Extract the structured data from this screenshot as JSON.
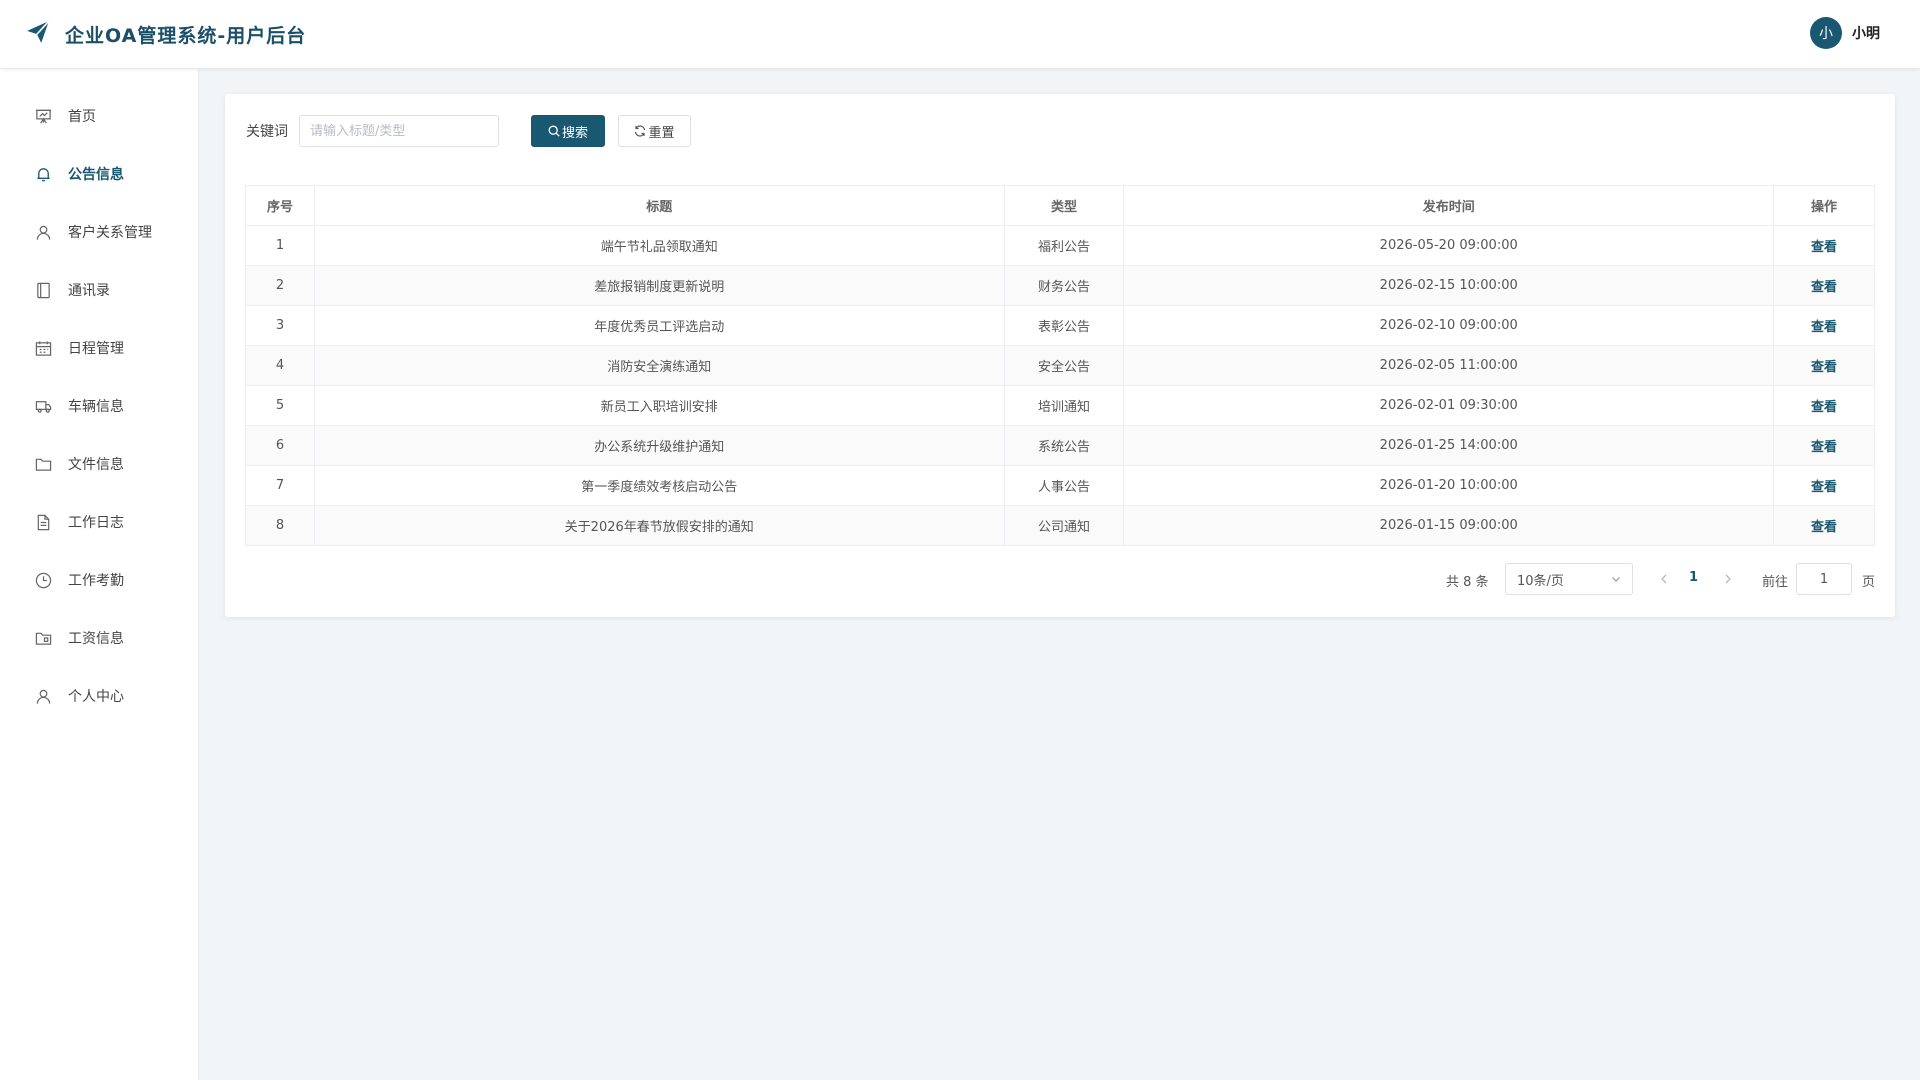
{
  "header": {
    "title": "企业OA管理系统-用户后台",
    "brand_color": "#1a5872",
    "user": {
      "avatar_text": "小",
      "name": "小明"
    }
  },
  "sidebar": {
    "items": [
      {
        "label": "首页",
        "icon": "presentation-icon",
        "active": false
      },
      {
        "label": "公告信息",
        "icon": "bell-icon",
        "active": true
      },
      {
        "label": "客户关系管理",
        "icon": "user-icon",
        "active": false
      },
      {
        "label": "通讯录",
        "icon": "notebook-icon",
        "active": false
      },
      {
        "label": "日程管理",
        "icon": "calendar-icon",
        "active": false
      },
      {
        "label": "车辆信息",
        "icon": "truck-icon",
        "active": false
      },
      {
        "label": "文件信息",
        "icon": "folder-icon",
        "active": false
      },
      {
        "label": "工作日志",
        "icon": "document-icon",
        "active": false
      },
      {
        "label": "工作考勤",
        "icon": "clock-icon",
        "active": false
      },
      {
        "label": "工资信息",
        "icon": "folder-money-icon",
        "active": false
      },
      {
        "label": "个人中心",
        "icon": "user-icon",
        "active": false
      }
    ]
  },
  "search": {
    "label": "关键词",
    "value": "",
    "placeholder": "请输入标题/类型",
    "search_button": "搜索",
    "reset_button": "重置"
  },
  "table": {
    "columns": [
      "序号",
      "标题",
      "类型",
      "发布时间",
      "操作"
    ],
    "rows": [
      {
        "index": "1",
        "title": "端午节礼品领取通知",
        "type": "福利公告",
        "time": "2026-05-20 09:00:00",
        "action": "查看"
      },
      {
        "index": "2",
        "title": "差旅报销制度更新说明",
        "type": "财务公告",
        "time": "2026-02-15 10:00:00",
        "action": "查看"
      },
      {
        "index": "3",
        "title": "年度优秀员工评选启动",
        "type": "表彰公告",
        "time": "2026-02-10 09:00:00",
        "action": "查看"
      },
      {
        "index": "4",
        "title": "消防安全演练通知",
        "type": "安全公告",
        "time": "2026-02-05 11:00:00",
        "action": "查看"
      },
      {
        "index": "5",
        "title": "新员工入职培训安排",
        "type": "培训通知",
        "time": "2026-02-01 09:30:00",
        "action": "查看"
      },
      {
        "index": "6",
        "title": "办公系统升级维护通知",
        "type": "系统公告",
        "time": "2026-01-25 14:00:00",
        "action": "查看"
      },
      {
        "index": "7",
        "title": "第一季度绩效考核启动公告",
        "type": "人事公告",
        "time": "2026-01-20 10:00:00",
        "action": "查看"
      },
      {
        "index": "8",
        "title": "关于2026年春节放假安排的通知",
        "type": "公司通知",
        "time": "2026-01-15 09:00:00",
        "action": "查看"
      }
    ]
  },
  "pagination": {
    "total_text": "共 8 条",
    "page_size": "10条/页",
    "current_page": "1",
    "goto_label": "前往",
    "goto_value": "1",
    "page_suffix": "页"
  }
}
